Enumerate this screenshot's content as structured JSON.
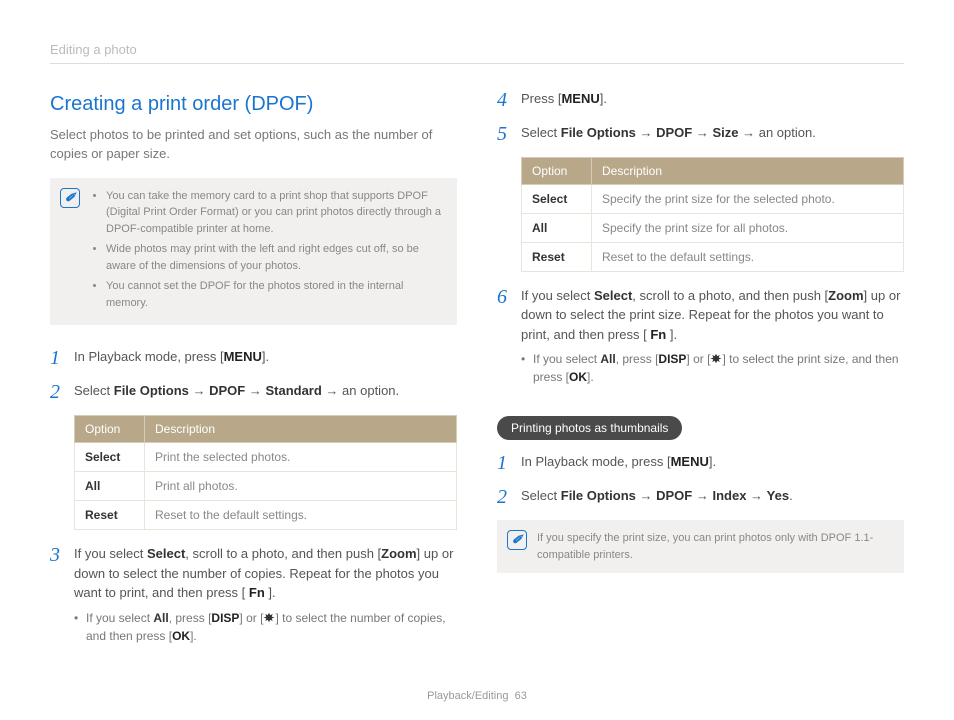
{
  "header": {
    "breadcrumb": "Editing a photo"
  },
  "left": {
    "title": "Creating a print order (DPOF)",
    "intro": "Select photos to be printed and set options, such as the number of copies or paper size.",
    "notes": [
      "You can take the memory card to a print shop that supports DPOF (Digital Print Order Format) or you can print photos directly through a DPOF-compatible printer at home.",
      "Wide photos may print with the left and right edges cut off, so be aware of the dimensions of your photos.",
      "You cannot set the DPOF for the photos stored in the internal memory."
    ],
    "steps": {
      "s1_pre": "In Playback mode, press [",
      "s1_btn": "MENU",
      "s1_post": "].",
      "s2_a": "Select ",
      "s2_b": "File Options",
      "s2_c": " → ",
      "s2_d": "DPOF",
      "s2_e": " → ",
      "s2_f": "Standard",
      "s2_g": " → an option.",
      "s3_a": "If you select ",
      "s3_b": "Select",
      "s3_c": ", scroll to a photo, and then push [",
      "s3_d": "Zoom",
      "s3_e": "] up or down to select the number of copies. Repeat for the photos you want to print, and then press [ ",
      "s3_f": "Fn",
      "s3_g": " ].",
      "s3_sub_a": "If you select ",
      "s3_sub_b": "All",
      "s3_sub_c": ", press [",
      "s3_sub_d": "DISP",
      "s3_sub_e": "] or [",
      "s3_sub_f": "] to select the number of copies, and then press [",
      "s3_sub_g": "OK",
      "s3_sub_h": "]."
    },
    "table": {
      "h1": "Option",
      "h2": "Description",
      "rows": [
        {
          "opt": "Select",
          "desc": "Print the selected photos."
        },
        {
          "opt": "All",
          "desc": "Print all photos."
        },
        {
          "opt": "Reset",
          "desc": "Reset to the default settings."
        }
      ]
    }
  },
  "right": {
    "steps": {
      "s4_a": "Press [",
      "s4_b": "MENU",
      "s4_c": "].",
      "s5_a": "Select ",
      "s5_b": "File Options",
      "s5_c": " → ",
      "s5_d": "DPOF",
      "s5_e": " → ",
      "s5_f": "Size",
      "s5_g": " → an option.",
      "s6_a": "If you select ",
      "s6_b": "Select",
      "s6_c": ", scroll to a photo, and then push [",
      "s6_d": "Zoom",
      "s6_e": "] up or down to select the print size. Repeat for the photos you want to print, and then press [ ",
      "s6_f": "Fn",
      "s6_g": " ].",
      "s6_sub_a": "If you select ",
      "s6_sub_b": "All",
      "s6_sub_c": ", press [",
      "s6_sub_d": "DISP",
      "s6_sub_e": "] or [",
      "s6_sub_f": "] to select the print size, and then press [",
      "s6_sub_g": "OK",
      "s6_sub_h": "]."
    },
    "table": {
      "h1": "Option",
      "h2": "Description",
      "rows": [
        {
          "opt": "Select",
          "desc": "Specify the print size for the selected photo."
        },
        {
          "opt": "All",
          "desc": "Specify the print size for all photos."
        },
        {
          "opt": "Reset",
          "desc": "Reset to the default settings."
        }
      ]
    },
    "pill": "Printing photos as thumbnails",
    "thumb": {
      "s1_a": "In Playback mode, press [",
      "s1_b": "MENU",
      "s1_c": "].",
      "s2_a": "Select ",
      "s2_b": "File Options",
      "s2_c": " → ",
      "s2_d": "DPOF",
      "s2_e": " → ",
      "s2_f": "Index",
      "s2_g": " → ",
      "s2_h": "Yes",
      "s2_i": "."
    },
    "note": "If you specify the print size, you can print photos only with DPOF 1.1-compatible printers."
  },
  "footer": {
    "section": "Playback/Editing",
    "page": "63"
  },
  "nums": {
    "n1": "1",
    "n2": "2",
    "n3": "3",
    "n4": "4",
    "n5": "5",
    "n6": "6"
  }
}
